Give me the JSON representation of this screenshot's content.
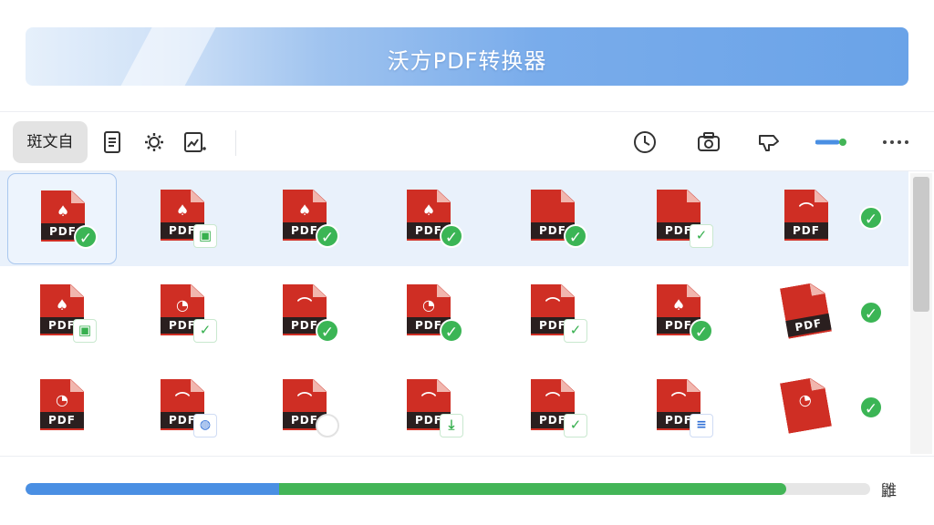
{
  "app": {
    "title": "沃方PDF转换器"
  },
  "toolbar": {
    "text_button": "斑文自",
    "icons_left": [
      "document-icon",
      "settings-gear-icon",
      "image-chart-icon"
    ],
    "icons_right": [
      "clock-icon",
      "camera-icon",
      "thumbs-down-icon",
      "slider-toggle-icon",
      "more-icon"
    ]
  },
  "files": [
    {
      "row": 0,
      "label": "PDF",
      "logo": "♠",
      "badge": "check"
    },
    {
      "row": 0,
      "label": "PDF",
      "logo": "♠",
      "badge": "square-frame"
    },
    {
      "row": 0,
      "label": "PDF",
      "logo": "♠",
      "badge": "check"
    },
    {
      "row": 0,
      "label": "PDF",
      "logo": "♠",
      "badge": "check"
    },
    {
      "row": 0,
      "label": "PDF",
      "logo": "",
      "badge": "check"
    },
    {
      "row": 0,
      "label": "PDF",
      "logo": "",
      "badge": "square-check"
    },
    {
      "row": 0,
      "label": "PDF",
      "logo": "⌒",
      "badge": "check"
    },
    {
      "row": 1,
      "label": "PDF",
      "logo": "♠",
      "badge": "square-frame"
    },
    {
      "row": 1,
      "label": "PDF",
      "logo": "◔",
      "badge": "square-check"
    },
    {
      "row": 1,
      "label": "PDF",
      "logo": "⌒",
      "badge": "check"
    },
    {
      "row": 1,
      "label": "PDF",
      "logo": "◔",
      "badge": "check"
    },
    {
      "row": 1,
      "label": "PDF",
      "logo": "⌒",
      "badge": "square-check"
    },
    {
      "row": 1,
      "label": "PDF",
      "logo": "♠",
      "badge": "check"
    },
    {
      "row": 1,
      "label": "PDF",
      "logo": "",
      "badge": "check"
    },
    {
      "row": 2,
      "label": "PDF",
      "logo": "◔",
      "badge": "none"
    },
    {
      "row": 2,
      "label": "PDF",
      "logo": "⌒",
      "badge": "globe"
    },
    {
      "row": 2,
      "label": "PDF",
      "logo": "⌒",
      "badge": "hollow"
    },
    {
      "row": 2,
      "label": "PDF",
      "logo": "⌒",
      "badge": "download"
    },
    {
      "row": 2,
      "label": "PDF",
      "logo": "⌒",
      "badge": "square-check"
    },
    {
      "row": 2,
      "label": "PDF",
      "logo": "⌒",
      "badge": "document"
    },
    {
      "row": 2,
      "label": "",
      "logo": "◔",
      "badge": "check"
    }
  ],
  "progress": {
    "blue_fraction": 0.3,
    "green_fraction": 0.6,
    "text": "䶆"
  },
  "colors": {
    "accent_blue": "#4a8fe3",
    "success_green": "#43b557",
    "pdf_red": "#cf2e24"
  }
}
